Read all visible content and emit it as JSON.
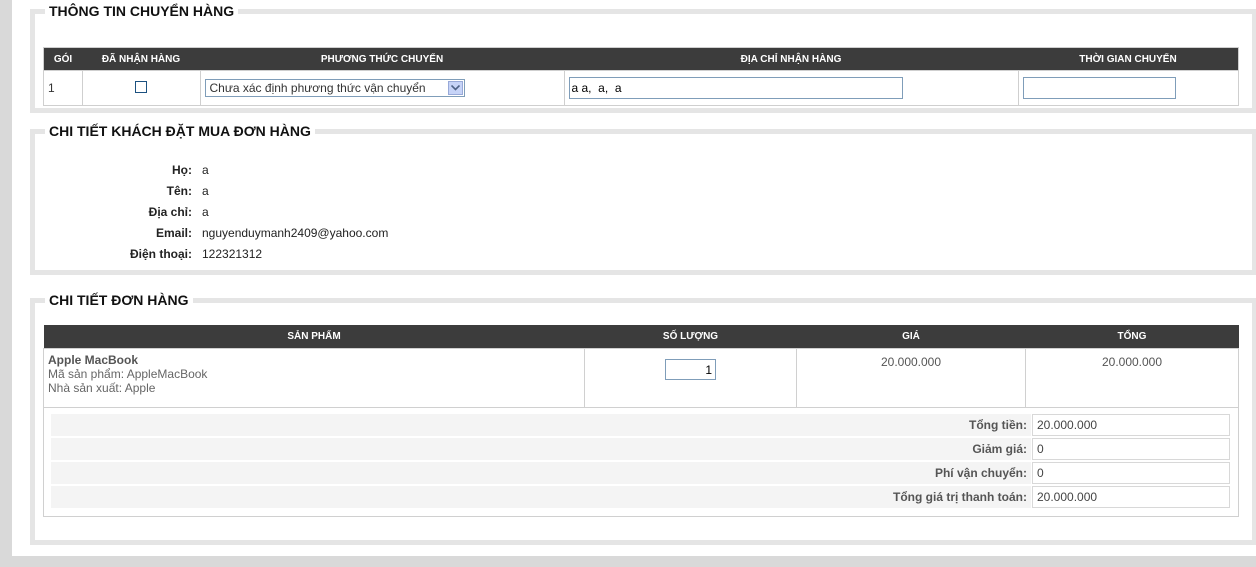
{
  "shipping": {
    "title": "THÔNG TIN CHUYỂN HÀNG",
    "headers": [
      "GÓI",
      "ĐÃ NHẬN HÀNG",
      "PHƯƠNG THỨC CHUYỂN",
      "ĐỊA CHỈ NHẬN HÀNG",
      "THỜI GIAN CHUYỂN"
    ],
    "row": {
      "package": "1",
      "received": false,
      "method": "Chưa xác định phương thức vận chuyển",
      "address": "a a,  a,  a",
      "time": ""
    }
  },
  "customer": {
    "title": "CHI TIẾT KHÁCH ĐẶT MUA ĐƠN HÀNG",
    "fields": [
      {
        "label": "Họ:",
        "value": "a"
      },
      {
        "label": "Tên:",
        "value": "a"
      },
      {
        "label": "Địa chỉ:",
        "value": "a"
      },
      {
        "label": "Email:",
        "value": "nguyenduymanh2409@yahoo.com"
      },
      {
        "label": "Điện thoại:",
        "value": "122321312"
      }
    ]
  },
  "order": {
    "title": "CHI TIẾT ĐƠN HÀNG",
    "headers": [
      "SẢN PHẨM",
      "SỐ LƯỢNG",
      "GIÁ",
      "TỔNG"
    ],
    "items": [
      {
        "name": "Apple MacBook",
        "code": "Mã sản phẩm: AppleMacBook",
        "manufacturer": "Nhà sản xuất: Apple",
        "quantity": "1",
        "price": "20.000.000",
        "total": "20.000.000"
      }
    ],
    "summary": [
      {
        "label": "Tổng tiền:",
        "value": "20.000.000"
      },
      {
        "label": "Giảm giá:",
        "value": "0"
      },
      {
        "label": "Phí vận chuyển:",
        "value": "0"
      },
      {
        "label": "Tổng giá trị thanh toán:",
        "value": "20.000.000"
      }
    ]
  },
  "colors": {
    "header_bg": "#3c3c3c",
    "frame_border": "#e5e5e5",
    "page_bg": "#d9d9d9"
  }
}
